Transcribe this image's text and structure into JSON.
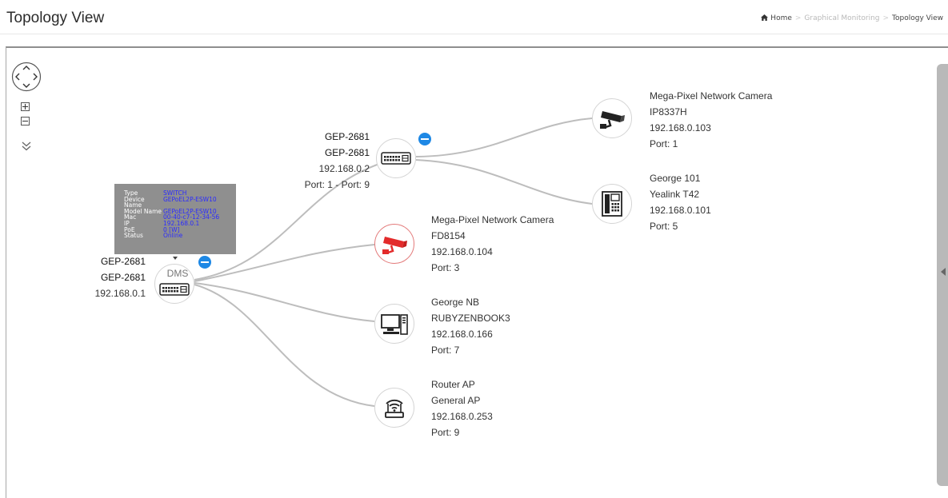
{
  "page": {
    "title": "Topology View"
  },
  "breadcrumb": {
    "home": "Home",
    "section": "Graphical Monitoring",
    "current": "Topology View"
  },
  "icons": {
    "home": "home-icon",
    "pan": "pan-arrows-icon",
    "zoom_in": "zoom-in-icon",
    "zoom_out": "zoom-out-icon",
    "collapse": "double-chevron-down-icon",
    "side_toggle": "caret-left-icon"
  },
  "colors": {
    "accent_blue": "#1e88e5",
    "alert_red": "#e32b2b",
    "link_gray": "#bdbdbd",
    "tooltip_value": "#2b2bff"
  },
  "tooltip": {
    "rows": [
      {
        "key": "Type",
        "value": "SWITCH"
      },
      {
        "key": "Device Name",
        "value": "GEPoEL2P-ESW10"
      },
      {
        "key": "Model Name",
        "value": "GEPoEL2P-ESW10"
      },
      {
        "key": "Mac",
        "value": "00-40-c7-12-34-56"
      },
      {
        "key": "IP",
        "value": "192.168.0.1"
      },
      {
        "key": "PoE",
        "value": "0 [W]"
      },
      {
        "key": "Status",
        "value": "Online"
      }
    ]
  },
  "nodes": {
    "root": {
      "badge": "DMS",
      "line1": "GEP-2681",
      "line2": "GEP-2681",
      "line3": "192.168.0.1",
      "icon": "switch-icon"
    },
    "switch2": {
      "line1": "GEP-2681",
      "line2": "GEP-2681",
      "line3": "192.168.0.2",
      "line4": "Port: 1 - Port: 9",
      "icon": "switch-icon"
    },
    "camera1": {
      "line1": "Mega-Pixel Network Camera",
      "line2": "IP8337H",
      "line3": "192.168.0.103",
      "line4": "Port: 1",
      "icon": "camera-icon"
    },
    "phone": {
      "line1": "George 101",
      "line2": "Yealink T42",
      "line3": "192.168.0.101",
      "line4": "Port: 5",
      "icon": "ip-phone-icon"
    },
    "camera2": {
      "line1": "Mega-Pixel Network Camera",
      "line2": "FD8154",
      "line3": "192.168.0.104",
      "line4": "Port: 3",
      "icon": "camera-alert-icon"
    },
    "pc": {
      "line1": "George NB",
      "line2": "RUBYZENBOOK3",
      "line3": "192.168.0.166",
      "line4": "Port: 7",
      "icon": "desktop-pc-icon"
    },
    "router": {
      "line1": "Router AP",
      "line2": "General AP",
      "line3": "192.168.0.253",
      "line4": "Port: 9",
      "icon": "wifi-router-icon"
    }
  }
}
